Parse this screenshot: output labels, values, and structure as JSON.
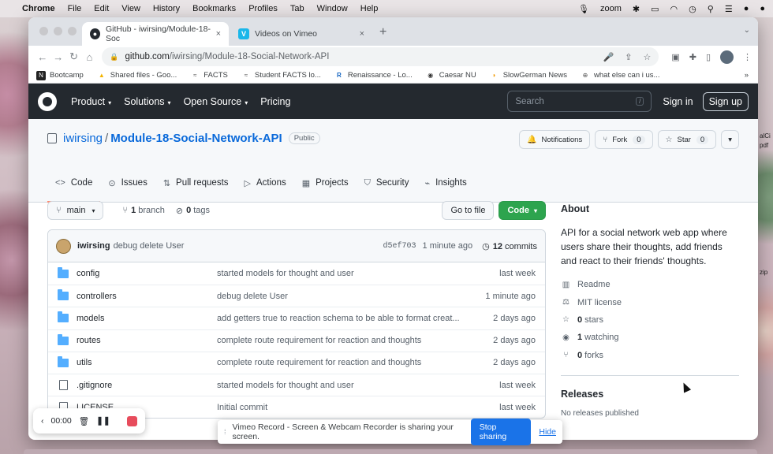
{
  "menubar": {
    "apple": "",
    "items": [
      "Chrome",
      "File",
      "Edit",
      "View",
      "History",
      "Bookmarks",
      "Profiles",
      "Tab",
      "Window",
      "Help"
    ],
    "zoom": "zoom"
  },
  "desktop": {
    "right_label_1": "alCi",
    "right_label_2": "pdf",
    "right_label_3": "zip"
  },
  "browser": {
    "tabs": [
      {
        "title": "GitHub - iwirsing/Module-18-Soc",
        "close": "×"
      },
      {
        "title": "Videos on Vimeo",
        "close": "×"
      }
    ],
    "new_tab": "+",
    "url_host": "github.com",
    "url_path": "/iwirsing/Module-18-Social-Network-API",
    "bookmarks": [
      "Bootcamp",
      "Shared files - Goo...",
      "FACTS",
      "Student FACTS lo...",
      "Renaissance - Lo...",
      "Caesar NU",
      "SlowGerman News",
      "what else can i us..."
    ],
    "bookmarks_more": "»"
  },
  "github": {
    "nav": [
      "Product",
      "Solutions",
      "Open Source",
      "Pricing"
    ],
    "search_placeholder": "Search",
    "search_key": "/",
    "sign_in": "Sign in",
    "sign_up": "Sign up",
    "repo": {
      "owner": "iwirsing",
      "sep": "/",
      "name": "Module-18-Social-Network-API",
      "visibility": "Public",
      "notifications": "Notifications",
      "fork_label": "Fork",
      "fork_count": "0",
      "star_label": "Star",
      "star_count": "0"
    },
    "tabs": [
      "Code",
      "Issues",
      "Pull requests",
      "Actions",
      "Projects",
      "Security",
      "Insights"
    ],
    "branch": "main",
    "branch_count": "1",
    "branch_label": "branch",
    "tag_count": "0",
    "tag_label": "tags",
    "go_to_file": "Go to file",
    "code_button": "Code",
    "commit": {
      "user": "iwirsing",
      "message": "debug delete User",
      "sha": "d5ef703",
      "ago": "1 minute ago",
      "count": "12",
      "count_label": "commits"
    },
    "files": [
      {
        "type": "folder",
        "name": "config",
        "message": "started models for thought and user",
        "age": "last week"
      },
      {
        "type": "folder",
        "name": "controllers",
        "message": "debug delete User",
        "age": "1 minute ago"
      },
      {
        "type": "folder",
        "name": "models",
        "message": "add getters true to reaction schema to be able to format creat...",
        "age": "2 days ago"
      },
      {
        "type": "folder",
        "name": "routes",
        "message": "complete route requirement for reaction and thoughts",
        "age": "2 days ago"
      },
      {
        "type": "folder",
        "name": "utils",
        "message": "complete route requirement for reaction and thoughts",
        "age": "2 days ago"
      },
      {
        "type": "file",
        "name": ".gitignore",
        "message": "started models for thought and user",
        "age": "last week"
      },
      {
        "type": "file",
        "name": "LICENSE",
        "message": "Initial commit",
        "age": "last week"
      }
    ],
    "about": {
      "heading": "About",
      "description": "API for a social network web app where users share their thoughts, add friends and react to their friends' thoughts.",
      "readme": "Readme",
      "license": "MIT license",
      "stars_count": "0",
      "stars_label": "stars",
      "watching_count": "1",
      "watching_label": "watching",
      "forks_count": "0",
      "forks_label": "forks"
    },
    "releases": {
      "heading": "Releases",
      "empty": "No releases published"
    }
  },
  "recorder": {
    "time": "00:00"
  },
  "share_bar": {
    "message": "Vimeo Record - Screen & Webcam Recorder is sharing your screen.",
    "stop": "Stop sharing",
    "hide": "Hide"
  }
}
